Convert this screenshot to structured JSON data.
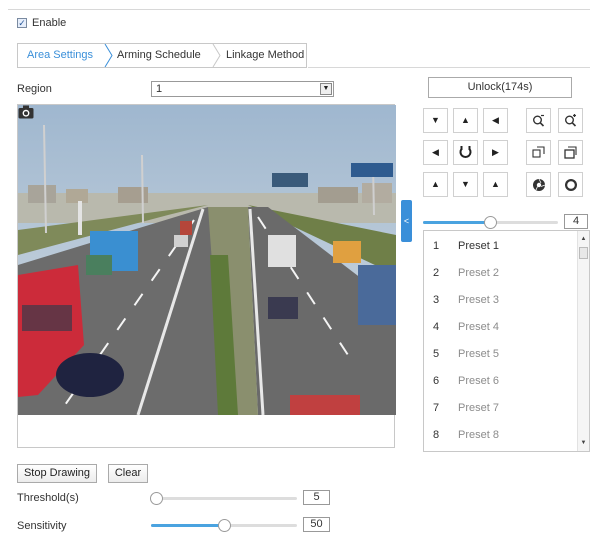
{
  "enable": {
    "label": "Enable",
    "checked": true
  },
  "tabs": [
    {
      "label": "Area Settings",
      "active": true
    },
    {
      "label": "Arming Schedule",
      "active": false
    },
    {
      "label": "Linkage Method",
      "active": false
    }
  ],
  "region": {
    "label": "Region",
    "value": "1"
  },
  "video": {
    "snapshot_icon": "camera-icon"
  },
  "drawing": {
    "stop_label": "Stop Drawing",
    "clear_label": "Clear"
  },
  "threshold": {
    "label": "Threshold(s)",
    "value": "5",
    "level": 0.0
  },
  "sensitivity": {
    "label": "Sensitivity",
    "value": "50",
    "level": 0.5
  },
  "ptz": {
    "unlock_label": "Unlock(174s)",
    "buttons": [
      "tilt-left-up-icon",
      "tilt-up-icon",
      "tilt-right-up-icon",
      "zoom-out-icon",
      "zoom-in-icon",
      "pan-left-icon",
      "auto-pan-icon",
      "pan-right-icon",
      "focus-near-icon",
      "focus-far-icon",
      "tilt-left-down-icon",
      "tilt-down-icon",
      "tilt-right-down-icon",
      "iris-close-icon",
      "iris-open-icon"
    ],
    "speed": {
      "value": "4",
      "level": 0.5
    },
    "collapse_icon": "chevron-left-icon"
  },
  "presets": [
    {
      "num": "1",
      "name": "Preset 1"
    },
    {
      "num": "2",
      "name": "Preset 2"
    },
    {
      "num": "3",
      "name": "Preset 3"
    },
    {
      "num": "4",
      "name": "Preset 4"
    },
    {
      "num": "5",
      "name": "Preset 5"
    },
    {
      "num": "6",
      "name": "Preset 6"
    },
    {
      "num": "7",
      "name": "Preset 7"
    },
    {
      "num": "8",
      "name": "Preset 8"
    }
  ],
  "colors": {
    "accent": "#3a8fd9",
    "slider_fill": "#4aa3e0",
    "border": "#c8c8c8"
  }
}
